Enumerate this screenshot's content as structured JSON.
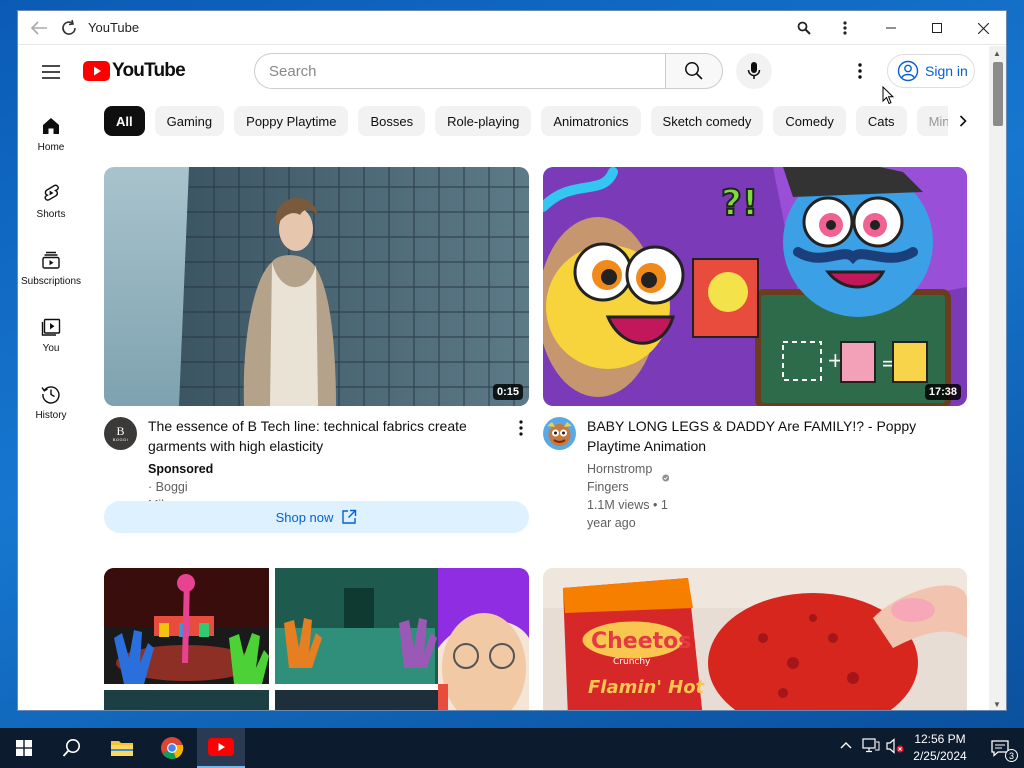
{
  "window": {
    "title": "YouTube"
  },
  "colors": {
    "brand_red": "#ff0000",
    "accent_blue": "#065fd4",
    "chip_bg": "#f2f2f2",
    "taskbar": "#0c1b2e"
  },
  "masthead": {
    "logo_text": "YouTube",
    "search_placeholder": "Search",
    "signin_label": "Sign in"
  },
  "sidebar": {
    "items": [
      {
        "label": "Home",
        "icon": "home-icon"
      },
      {
        "label": "Shorts",
        "icon": "shorts-icon"
      },
      {
        "label": "Subscriptions",
        "icon": "subscriptions-icon"
      },
      {
        "label": "You",
        "icon": "you-icon"
      },
      {
        "label": "History",
        "icon": "history-icon"
      }
    ]
  },
  "chips": [
    "All",
    "Gaming",
    "Poppy Playtime",
    "Bosses",
    "Role-playing",
    "Animatronics",
    "Sketch comedy",
    "Comedy",
    "Cats",
    "Mine"
  ],
  "videos": [
    {
      "title_line1": "The essence of B Tech line: technical fabrics create",
      "title_line2": "garments with high elasticity",
      "duration": "0:15",
      "sponsored": "Sponsored",
      "separator": "·",
      "channel": "Boggi Milano",
      "avatar_text": "B",
      "avatar_subtext": "BOGGI",
      "cta": "Shop now"
    },
    {
      "title_line1": "BABY LONG LEGS & DADDY Are FAMILY!? - Poppy",
      "title_line2": "Playtime Animation",
      "duration": "17:38",
      "channel": "Hornstromp Fingers",
      "views": "1.1M views",
      "separator": "•",
      "age": "1 year ago"
    }
  ],
  "thumbnail_text": {
    "brand": "Cheetos",
    "sub": "Crunchy",
    "flavor": "Flamin' Hot"
  },
  "taskbar": {
    "time": "12:56 PM",
    "date": "2/25/2024",
    "notification_count": "3"
  }
}
